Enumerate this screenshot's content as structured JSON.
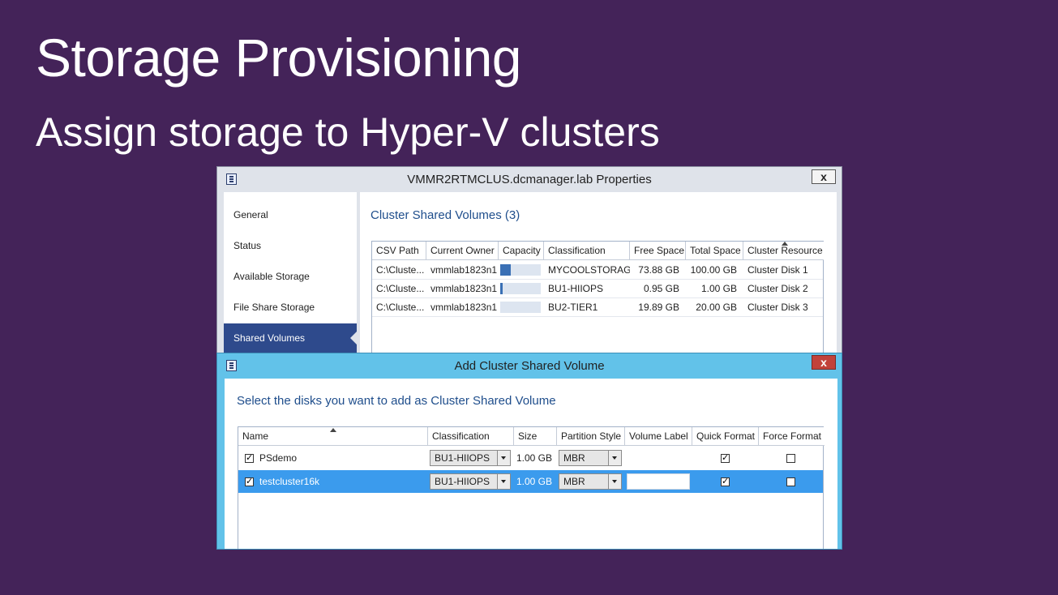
{
  "slide": {
    "title": "Storage Provisioning",
    "subtitle": "Assign storage to Hyper-V clusters"
  },
  "properties_window": {
    "title": "VMMR2RTMCLUS.dcmanager.lab Properties",
    "close_label": "x",
    "nav": [
      {
        "label": "General"
      },
      {
        "label": "Status"
      },
      {
        "label": "Available Storage"
      },
      {
        "label": "File Share Storage"
      },
      {
        "label": "Shared Volumes",
        "active": true
      }
    ],
    "section_title": "Cluster Shared Volumes (3)",
    "columns": [
      "CSV Path",
      "Current Owner",
      "Capacity",
      "Classification",
      "Free Space",
      "Total Space",
      "Cluster Resource"
    ],
    "rows": [
      {
        "path": "C:\\Cluste...",
        "owner": "vmmlab1823n1",
        "capacity_used_fraction": 0.26,
        "classification": "MYCOOLSTORAGE",
        "free": "73.88 GB",
        "total": "100.00 GB",
        "resource": "Cluster Disk 1"
      },
      {
        "path": "C:\\Cluste...",
        "owner": "vmmlab1823n1",
        "capacity_used_fraction": 0.05,
        "classification": "BU1-HIIOPS",
        "free": "0.95 GB",
        "total": "1.00 GB",
        "resource": "Cluster Disk 2"
      },
      {
        "path": "C:\\Cluste...",
        "owner": "vmmlab1823n1",
        "capacity_used_fraction": 0.0,
        "classification": "BU2-TIER1",
        "free": "19.89 GB",
        "total": "20.00 GB",
        "resource": "Cluster Disk 3"
      }
    ]
  },
  "add_csv_dialog": {
    "title": "Add Cluster Shared Volume",
    "close_label": "x",
    "instruction": "Select the disks you want to add as Cluster Shared Volume",
    "columns": [
      "Name",
      "Classification",
      "Size",
      "Partition Style",
      "Volume Label",
      "Quick Format",
      "Force Format"
    ],
    "rows": [
      {
        "checked": true,
        "name": "PSdemo",
        "classification": "BU1-HIIOPS",
        "size": "1.00 GB",
        "partition_style": "MBR",
        "volume_label": "",
        "quick_format": true,
        "force_format": false,
        "selected": false
      },
      {
        "checked": true,
        "name": "testcluster16k",
        "classification": "BU1-HIIOPS",
        "size": "1.00 GB",
        "partition_style": "MBR",
        "volume_label": "",
        "quick_format": true,
        "force_format": false,
        "selected": true
      }
    ]
  },
  "colors": {
    "slide_bg": "#442359",
    "accent_text": "#1f4e8c",
    "nav_active": "#2e4a8c",
    "dialog_frame": "#62c2e9",
    "selected_row": "#3b9bed",
    "close_red": "#c2423a"
  },
  "icons": {
    "window_icon": "app-window-icon",
    "checkbox": "checkbox-icon",
    "dropdown": "chevron-down-icon",
    "sort": "sort-ascending-icon"
  }
}
